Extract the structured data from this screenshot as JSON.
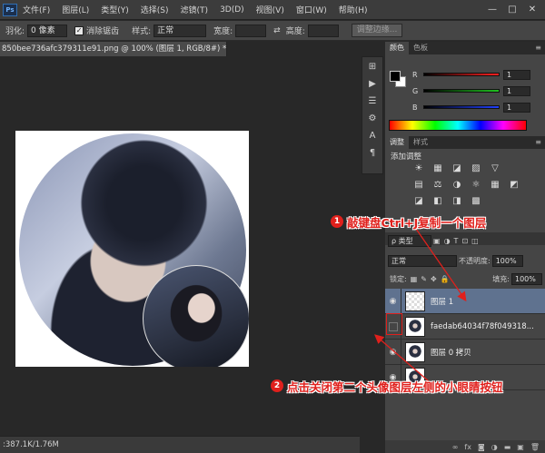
{
  "menu": {
    "logo": "Ps",
    "items": [
      "文件(F)",
      "图层(L)",
      "类型(Y)",
      "选择(S)",
      "滤镜(T)",
      "3D(D)",
      "视图(V)",
      "窗口(W)",
      "帮助(H)"
    ],
    "window_controls": [
      "—",
      "□",
      "✕"
    ]
  },
  "options": {
    "feather_label": "羽化:",
    "feather_value": "0 像素",
    "antialias_label": "消除锯齿",
    "style_label": "样式:",
    "style_value": "正常",
    "width_label": "宽度:",
    "height_label": "高度:",
    "refine_button": "调整边缘..."
  },
  "document": {
    "tab_title": "850bee736afc379311e91.png @ 100% (图层 1, RGB/8#) * ✕",
    "status": ":387.1K/1.76M"
  },
  "toolstrip": {
    "icons": [
      "history-icon",
      "play-icon",
      "layer-comps-icon",
      "brush-presets-icon",
      "character-icon",
      "paragraph-icon"
    ],
    "glyphs": [
      "⊞",
      "▶",
      "☰",
      "⚙",
      "A",
      "¶"
    ]
  },
  "color_panel": {
    "tabs": [
      "颜色",
      "色板"
    ],
    "channels": [
      {
        "label": "R",
        "value": "1",
        "color": "#ff2020"
      },
      {
        "label": "G",
        "value": "1",
        "color": "#20c020"
      },
      {
        "label": "B",
        "value": "1",
        "color": "#2040ff"
      }
    ]
  },
  "adjust_panel": {
    "tabs": [
      "调整",
      "样式"
    ],
    "title": "添加调整",
    "icons": [
      "☀",
      "▦",
      "◪",
      "▨",
      "▽",
      "▤",
      "⚖",
      "◑",
      "⚛",
      "▦",
      "◩",
      "◪",
      "◧",
      "◨",
      "▩"
    ]
  },
  "layers_panel": {
    "filter_label": "ρ 类型",
    "blend_mode": "正常",
    "opacity_label": "不透明度:",
    "opacity_value": "100%",
    "lock_label": "锁定:",
    "fill_label": "填充:",
    "fill_value": "100%",
    "layers": [
      {
        "name": "图层 1",
        "selected": true,
        "visible": true
      },
      {
        "name": "faedab64034f78f049318...",
        "selected": false,
        "visible": false
      },
      {
        "name": "图层 0 拷贝",
        "selected": false,
        "visible": true
      },
      {
        "name": "",
        "selected": false,
        "visible": true
      }
    ],
    "footer_icons": [
      "∞",
      "fx",
      "◙",
      "◑",
      "▬",
      "▣",
      "🗑"
    ]
  },
  "annotations": [
    {
      "number": "1",
      "text": "敲键盘Ctrl+J复制一个图层"
    },
    {
      "number": "2",
      "text": "点击关闭第二个头像图层左侧的小眼睛按钮"
    }
  ],
  "colors": {
    "annotation": "#e0201c",
    "selected_layer": "#5f728f"
  }
}
